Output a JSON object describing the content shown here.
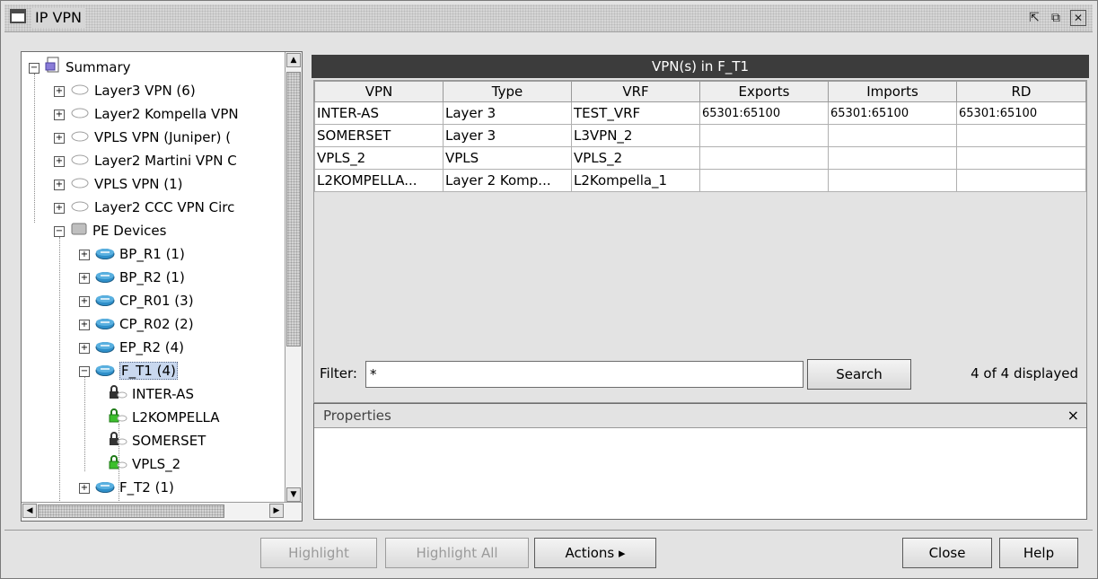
{
  "window": {
    "title": "IP VPN"
  },
  "tree": {
    "items": [
      {
        "label": "Summary",
        "expander": "−",
        "icon": "summary"
      },
      {
        "label": "Layer3 VPN (6)",
        "expander": "+",
        "icon": "cloud"
      },
      {
        "label": "Layer2 Kompella VPN",
        "expander": "+",
        "icon": "cloud"
      },
      {
        "label": "VPLS VPN (Juniper) (",
        "expander": "+",
        "icon": "cloud"
      },
      {
        "label": "Layer2 Martini VPN C",
        "expander": "+",
        "icon": "cloud"
      },
      {
        "label": "VPLS VPN (1)",
        "expander": "+",
        "icon": "cloud"
      },
      {
        "label": "Layer2 CCC VPN Circ",
        "expander": "+",
        "icon": "cloud"
      },
      {
        "label": "PE Devices",
        "expander": "−",
        "icon": "database"
      },
      {
        "label": "BP_R1 (1)",
        "expander": "+",
        "icon": "router"
      },
      {
        "label": "BP_R2 (1)",
        "expander": "+",
        "icon": "router"
      },
      {
        "label": "CP_R01 (3)",
        "expander": "+",
        "icon": "router"
      },
      {
        "label": "CP_R02 (2)",
        "expander": "+",
        "icon": "router"
      },
      {
        "label": "EP_R2 (4)",
        "expander": "+",
        "icon": "router"
      },
      {
        "label": "F_T1 (4)",
        "expander": "−",
        "icon": "router",
        "selected": true
      },
      {
        "label": "INTER-AS",
        "expander": "",
        "icon": "lock-dark"
      },
      {
        "label": "L2KOMPELLA",
        "expander": "",
        "icon": "lock-green"
      },
      {
        "label": "SOMERSET",
        "expander": "",
        "icon": "lock-dark"
      },
      {
        "label": "VPLS_2",
        "expander": "",
        "icon": "lock-green"
      },
      {
        "label": "F_T2 (1)",
        "expander": "+",
        "icon": "router"
      }
    ]
  },
  "vpn_table": {
    "title": "VPN(s) in F_T1",
    "columns": [
      "VPN",
      "Type",
      "VRF",
      "Exports",
      "Imports",
      "RD"
    ],
    "rows": [
      [
        "INTER-AS",
        "Layer 3",
        "TEST_VRF",
        "65301:65100",
        "65301:65100",
        "65301:65100"
      ],
      [
        "SOMERSET",
        "Layer 3",
        "L3VPN_2",
        "",
        "",
        ""
      ],
      [
        "VPLS_2",
        "VPLS",
        "VPLS_2",
        "",
        "",
        ""
      ],
      [
        "L2KOMPELLA...",
        "Layer 2 Komp...",
        "L2Kompella_1",
        "",
        "",
        ""
      ]
    ]
  },
  "filter": {
    "label": "Filter:",
    "value": "*",
    "search_label": "Search",
    "count_text": "4 of 4 displayed"
  },
  "properties": {
    "title": "Properties",
    "close_glyph": "×"
  },
  "buttons": {
    "highlight": "Highlight",
    "highlight_all": "Highlight All",
    "actions": "Actions ▸",
    "close": "Close",
    "help": "Help"
  },
  "colors": {
    "header_bg": "#3c3c3c",
    "router_icon": "#2f8fc9",
    "lock_green": "#3cbf2c"
  }
}
